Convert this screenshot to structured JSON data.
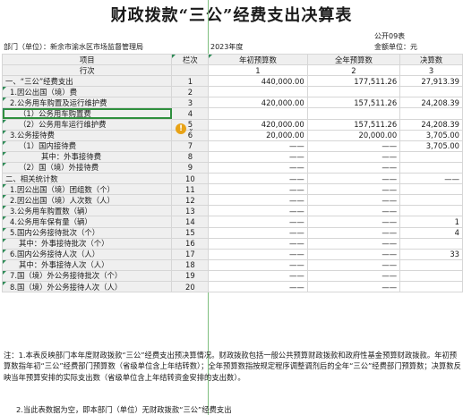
{
  "title": "财政拨款“三公”经费支出决算表",
  "meta": {
    "form_code": "公开09表",
    "unit_label": "部门（单位）：新余市渝水区市场监督管理局",
    "year": "2023年度",
    "amount_unit": "金额单位：元"
  },
  "header": {
    "item": "项目",
    "col": "栏次",
    "budget_start": "年初预算数",
    "budget_full": "全年预算数",
    "final": "决算数",
    "row_label": "行次",
    "n1": "1",
    "n2": "2",
    "n3": "3"
  },
  "rows": [
    {
      "label": "一、“三公”经费支出",
      "no": "1",
      "a": "440,000.00",
      "b": "177,511.26",
      "c": "27,913.39"
    },
    {
      "label": "1.因公出国（境）费",
      "no": "2",
      "a": "",
      "b": "",
      "c": ""
    },
    {
      "label": "2.公务用车购置及运行维护费",
      "no": "3",
      "a": "420,000.00",
      "b": "157,511.26",
      "c": "24,208.39"
    },
    {
      "label": "（1）公务用车购置费",
      "no": "4",
      "a": "",
      "b": "",
      "c": ""
    },
    {
      "label": "（2）公务用车运行维护费",
      "no": "5",
      "a": "420,000.00",
      "b": "157,511.26",
      "c": "24,208.39"
    },
    {
      "label": "3.公务接待费",
      "no": "6",
      "a": "20,000.00",
      "b": "20,000.00",
      "c": "3,705.00"
    },
    {
      "label": "（1）国内接待费",
      "no": "7",
      "a": "——",
      "b": "——",
      "c": "3,705.00"
    },
    {
      "label": "其中：外事接待费",
      "no": "8",
      "a": "——",
      "b": "——",
      "c": ""
    },
    {
      "label": "（2）国（境）外接待费",
      "no": "9",
      "a": "——",
      "b": "——",
      "c": ""
    },
    {
      "label": "二、相关统计数",
      "no": "10",
      "a": "——",
      "b": "——",
      "c": "——"
    },
    {
      "label": "1.因公出国（境）团组数（个）",
      "no": "11",
      "a": "——",
      "b": "——",
      "c": ""
    },
    {
      "label": "2.因公出国（境）人次数（人）",
      "no": "12",
      "a": "——",
      "b": "——",
      "c": ""
    },
    {
      "label": "3.公务用车购置数（辆）",
      "no": "13",
      "a": "——",
      "b": "——",
      "c": ""
    },
    {
      "label": "4.公务用车保有量（辆）",
      "no": "14",
      "a": "——",
      "b": "——",
      "c": "1"
    },
    {
      "label": "5.国内公务接待批次（个）",
      "no": "15",
      "a": "——",
      "b": "——",
      "c": "4"
    },
    {
      "label": "其中：外事接待批次（个）",
      "no": "16",
      "a": "——",
      "b": "——",
      "c": ""
    },
    {
      "label": "6.国内公务接待人次（人）",
      "no": "17",
      "a": "——",
      "b": "——",
      "c": "33"
    },
    {
      "label": "其中：外事接待人次（人）",
      "no": "18",
      "a": "——",
      "b": "——",
      "c": ""
    },
    {
      "label": "7.国（境）外公务接待批次（个）",
      "no": "19",
      "a": "——",
      "b": "——",
      "c": ""
    },
    {
      "label": "8.国（境）外公务接待人次（人）",
      "no": "20",
      "a": "——",
      "b": "——",
      "c": ""
    }
  ],
  "notes": {
    "n1": "注：1.本表反映部门本年度财政拨款“三公”经费支出预决算情况。财政拨款包括一般公共预算财政拨款和政府性基金预算财政拨款。年初预算数指年初“三公”经费部门预算数（省级单位含上年结转数）；全年预算数指按规定程序调整调剂后的全年“三公”经费部门预算数；决算数反映当年预算安排的实际支出数（省级单位含上年结转资金安排的支出数）。",
    "n2": "2.当此表数据为空，即本部门（单位）无财政拨款“三公”经费支出"
  },
  "cell_state": {
    "selected_row": "4",
    "warning_icon": "warning-icon",
    "dropdown_icon": "chevron-down-icon"
  },
  "colors": {
    "selection": "#2f8f3e",
    "warning": "#e8a317",
    "label_bg": "#efefef"
  }
}
